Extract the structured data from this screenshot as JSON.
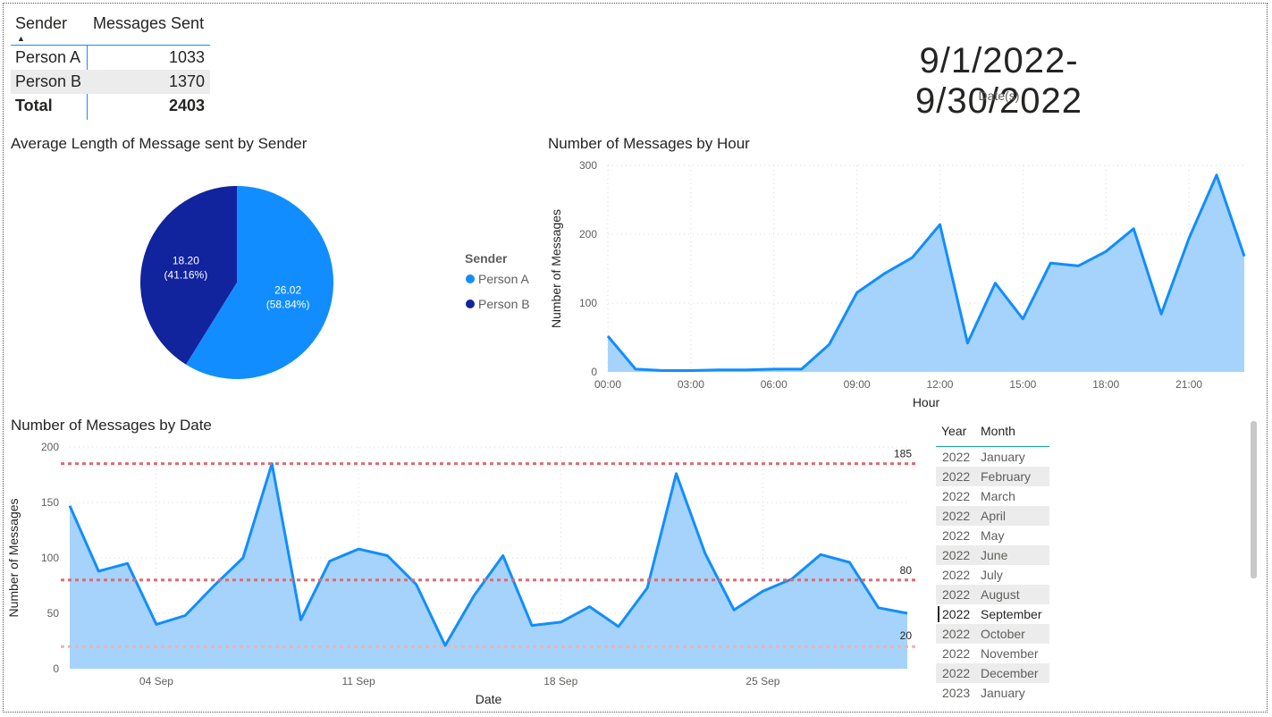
{
  "summary_table": {
    "headers": [
      "Sender",
      "Messages Sent"
    ],
    "rows": [
      {
        "sender": "Person A",
        "count": "1033"
      },
      {
        "sender": "Person B",
        "count": "1370"
      }
    ],
    "total": {
      "label": "Total",
      "count": "2403"
    }
  },
  "date_card": {
    "value": "9/1/2022-9/30/2022",
    "label": "Date(s)"
  },
  "colors": {
    "light_blue": "#118dff",
    "dark_blue": "#12239e",
    "area_fill": "#a6d3fc",
    "ref_line": "#de6a73",
    "ref_line_low": "#e8b4b8"
  },
  "chart_data": [
    {
      "type": "pie",
      "title": "Average Length of Message sent by Sender",
      "legend_title": "Sender",
      "legend_position": "right",
      "slices": [
        {
          "name": "Person A",
          "value": 26.02,
          "percent": "58.84%",
          "label": "26.02",
          "pct_label": "(58.84%)"
        },
        {
          "name": "Person B",
          "value": 18.2,
          "percent": "41.16%",
          "label": "18.20",
          "pct_label": "(41.16%)"
        }
      ]
    },
    {
      "type": "area",
      "title": "Number of Messages by Hour",
      "xlabel": "Hour",
      "ylabel": "Number of Messages",
      "ylim": [
        0,
        300
      ],
      "yticks": [
        "0",
        "100",
        "200",
        "300"
      ],
      "xticks": [
        "00:00",
        "03:00",
        "06:00",
        "09:00",
        "12:00",
        "15:00",
        "18:00",
        "21:00"
      ],
      "x": [
        0,
        1,
        2,
        3,
        4,
        5,
        6,
        7,
        8,
        9,
        10,
        11,
        12,
        13,
        14,
        15,
        16,
        17,
        18,
        19,
        20,
        21,
        22,
        23
      ],
      "values": [
        52,
        4,
        2,
        2,
        3,
        3,
        4,
        4,
        40,
        115,
        143,
        166,
        214,
        42,
        129,
        77,
        158,
        154,
        175,
        208,
        84,
        194,
        286,
        168
      ],
      "grid": true
    },
    {
      "type": "area",
      "title": "Number of Messages by Date",
      "xlabel": "Date",
      "ylabel": "Number of Messages",
      "ylim": [
        0,
        200
      ],
      "yticks": [
        "0",
        "50",
        "100",
        "150",
        "200"
      ],
      "xticks": [
        {
          "day": 4,
          "label": "04 Sep"
        },
        {
          "day": 11,
          "label": "11 Sep"
        },
        {
          "day": 18,
          "label": "18 Sep"
        },
        {
          "day": 25,
          "label": "25 Sep"
        }
      ],
      "x": [
        1,
        2,
        3,
        4,
        5,
        6,
        7,
        8,
        9,
        10,
        11,
        12,
        13,
        14,
        15,
        16,
        17,
        18,
        19,
        20,
        21,
        22,
        23,
        24,
        25,
        26,
        27,
        28,
        29,
        30
      ],
      "values": [
        147,
        88,
        95,
        40,
        48,
        75,
        100,
        185,
        44,
        97,
        108,
        102,
        76,
        21,
        66,
        102,
        39,
        42,
        56,
        38,
        73,
        176,
        104,
        53,
        70,
        81,
        103,
        96,
        55,
        50
      ],
      "reference_lines": [
        {
          "value": 185,
          "label": "185",
          "kind": "max"
        },
        {
          "value": 80,
          "label": "80",
          "kind": "average"
        },
        {
          "value": 20,
          "label": "20",
          "kind": "min"
        }
      ],
      "grid": true
    }
  ],
  "slicer": {
    "headers": [
      "Year",
      "Month"
    ],
    "items": [
      {
        "year": "2022",
        "month": "January"
      },
      {
        "year": "2022",
        "month": "February"
      },
      {
        "year": "2022",
        "month": "March"
      },
      {
        "year": "2022",
        "month": "April"
      },
      {
        "year": "2022",
        "month": "May"
      },
      {
        "year": "2022",
        "month": "June"
      },
      {
        "year": "2022",
        "month": "July"
      },
      {
        "year": "2022",
        "month": "August"
      },
      {
        "year": "2022",
        "month": "September",
        "selected": true
      },
      {
        "year": "2022",
        "month": "October"
      },
      {
        "year": "2022",
        "month": "November"
      },
      {
        "year": "2022",
        "month": "December"
      },
      {
        "year": "2023",
        "month": "January"
      }
    ]
  }
}
